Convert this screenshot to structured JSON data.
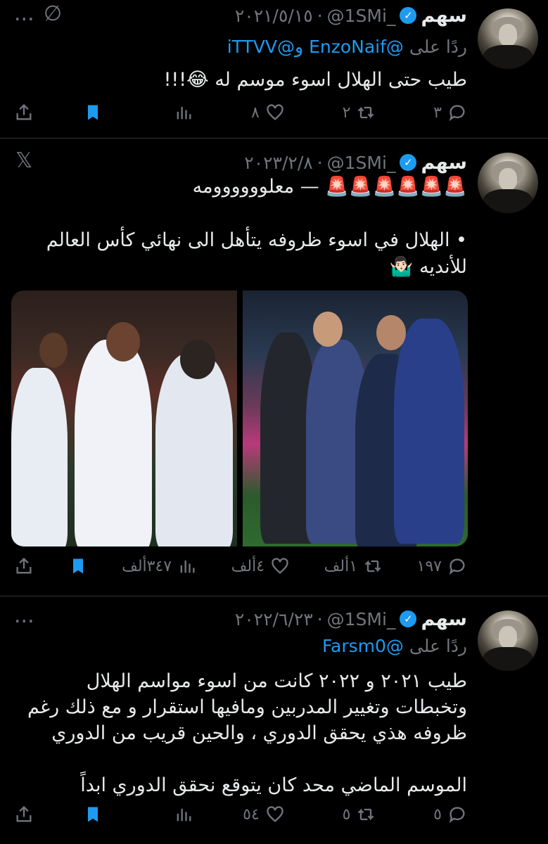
{
  "tweets": [
    {
      "name": "سهم",
      "verified_mark": "✓",
      "handle": "@1SMi_",
      "separator": "·",
      "date": "٢٠٢١/٥/١٥",
      "corner": [
        "...",
        "∅"
      ],
      "reply_prefix": "ردًا على",
      "reply_to": "@EnzoNaif و@iTTVV",
      "text": "طيب حتى الهلال اسوء موسم له 😂!!!",
      "replies": "٣",
      "retweets": "٢",
      "likes": "٨",
      "views": ""
    },
    {
      "name": "سهم",
      "verified_mark": "✓",
      "handle": "@1SMi_",
      "separator": "·",
      "date": "٢٠٢٣/٢/٨",
      "corner": "𝕏",
      "text": "🚨🚨🚨🚨🚨🚨 — معلوووووومه\n\n• الهلال في اسوء ظروفه يتأهل الى نهائي كأس العالم للأنديه 🤷🏻‍♂️",
      "replies": "١٩٧",
      "retweets": "١ألف",
      "likes": "٤ألف",
      "views": "٣٤٧ألف"
    },
    {
      "name": "سهم",
      "verified_mark": "✓",
      "handle": "@1SMi_",
      "separator": "·",
      "date": "٢٠٢٢/٦/٢٣",
      "corner": "...",
      "reply_prefix": "ردًا على",
      "reply_to": "@Farsm0",
      "text": "طيب ٢٠٢١ و ٢٠٢٢ كانت من اسوء مواسم الهلال وتخبطات وتغيير المدربين ومافيها استقرار و مع ذلك رغم ظروفه هذي يحقق الدوري ، والحين قريب من الدوري\n\nالموسم الماضي محد كان يتوقع نحقق الدوري ابداً",
      "replies": "٥",
      "retweets": "٥",
      "likes": "٥٤",
      "views": ""
    }
  ],
  "colors": {
    "background": "#000000",
    "text": "#e7e9ea",
    "muted": "#71767b",
    "accent": "#1d9bf0",
    "divider": "#2f3336"
  },
  "icons": {
    "reply": "reply-icon",
    "retweet": "retweet-icon",
    "like": "heart-icon",
    "views": "views-icon",
    "bookmark": "bookmark-icon",
    "share": "share-icon"
  }
}
